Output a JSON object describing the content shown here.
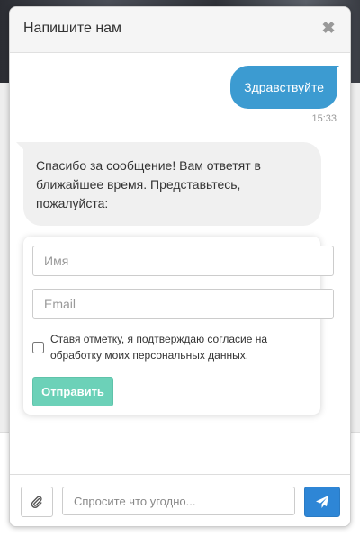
{
  "header": {
    "title": "Напишите нам",
    "close_icon": "close-icon"
  },
  "messages": {
    "outgoing": {
      "text": "Здравствуйте",
      "time": "15:33"
    },
    "incoming": {
      "text": "Спасибо за сообщение! Вам ответят в ближайшее время. Представьтесь, пожалуйста:"
    }
  },
  "form": {
    "name_placeholder": "Имя",
    "email_placeholder": "Email",
    "consent_label": "Ставя отметку, я подтверждаю согласие на обработку моих персональных данных.",
    "consent_checked": false,
    "submit_label": "Отправить"
  },
  "footer": {
    "attach_icon": "paperclip-icon",
    "input_placeholder": "Спросите что угодно...",
    "send_icon": "paper-plane-icon"
  },
  "colors": {
    "outgoing_bubble": "#3c9bd1",
    "incoming_bubble": "#f0f0f0",
    "submit_button": "#6cd1b8",
    "send_button": "#2e86d6"
  }
}
